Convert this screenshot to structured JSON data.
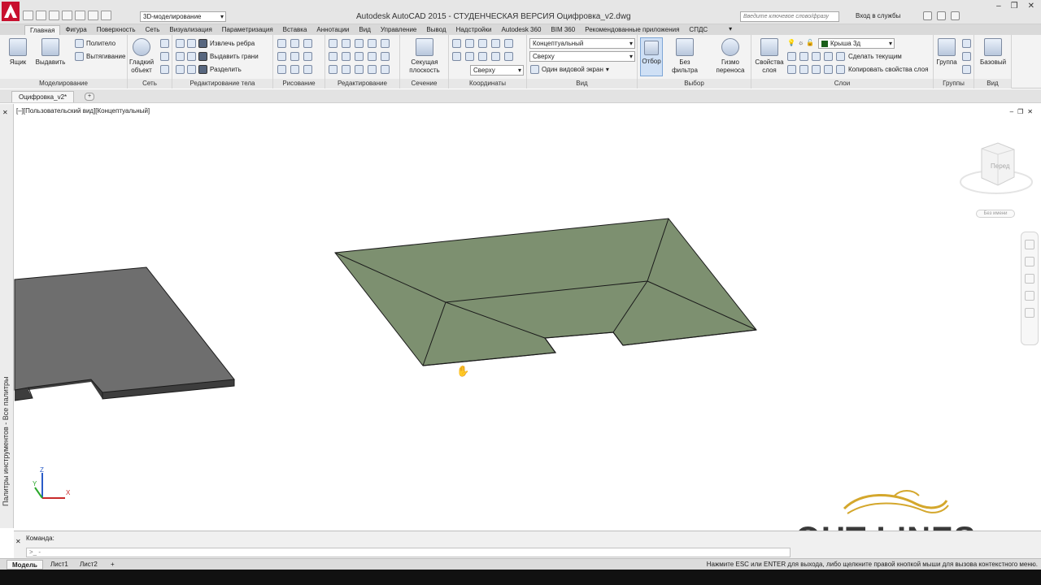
{
  "titlebar": {
    "workspace": "3D-моделирование",
    "title": "Autodesk AutoCAD 2015 - СТУДЕНЧЕСКАЯ ВЕРСИЯ    Оцифровка_v2.dwg",
    "search_placeholder": "Введите ключевое слово/фразу",
    "signin": "Вход в службы"
  },
  "ribbon_tabs": [
    "Главная",
    "Фигура",
    "Поверхность",
    "Сеть",
    "Визуализация",
    "Параметризация",
    "Вставка",
    "Аннотации",
    "Вид",
    "Управление",
    "Вывод",
    "Надстройки",
    "Autodesk 360",
    "BIM 360",
    "Рекомендованные приложения",
    "СПДС"
  ],
  "ribbon": {
    "modeling": {
      "title": "Моделирование",
      "box": "Ящик",
      "extrude": "Выдавить",
      "polysolid": "Политело",
      "presspull": "Вытягивание"
    },
    "mesh": {
      "title": "Сеть",
      "smooth": "Гладкий объект"
    },
    "solid_edit": {
      "title": "Редактирование тела",
      "extract_edges": "Извлечь ребра",
      "extrude_faces": "Выдавить грани",
      "separate": "Разделить"
    },
    "draw": {
      "title": "Рисование"
    },
    "modify": {
      "title": "Редактирование"
    },
    "section": {
      "title": "Сечение",
      "plane": "Секущая плоскость"
    },
    "coordinates": {
      "title": "Координаты",
      "combo": "Сверху"
    },
    "view": {
      "title": "Вид",
      "visual_style": "Концептуальный",
      "view_dir": "Сверху",
      "single_vp": "Один видовой экран"
    },
    "selection": {
      "title": "Выбор",
      "culling": "Отбор",
      "no_filter": "Без фильтра",
      "gizmo": "Гизмо переноса"
    },
    "layers": {
      "title": "Слои",
      "properties": "Свойства слоя",
      "layer": "Крыша 3д",
      "make_current": "Сделать текущим",
      "match": "Копировать свойства слоя"
    },
    "groups": {
      "title": "Группы",
      "group": "Группа"
    },
    "base": {
      "title": "Вид",
      "base": "Базовый"
    }
  },
  "file_tab": "Оцифровка_v2*",
  "viewport": {
    "label": "[–][Пользовательский вид][Концептуальный]",
    "viewcube_face": "Перед",
    "unnamed_ucs": "Без имени"
  },
  "palette": {
    "title": "Палитры инструментов - Все палитры"
  },
  "command": {
    "history": "Команда:",
    "prompt": ">_ -"
  },
  "status": {
    "tabs": [
      "Модель",
      "Лист1",
      "Лист2"
    ],
    "message": "Нажмите ESC или ENTER для выхода, либо щелкните правой кнопкой мыши для вызова контекстного меню."
  },
  "watermark": "OUT-LINES",
  "colors": {
    "roof_fill": "#7d9070",
    "slab_fill": "#6e6e6e",
    "accent": "#c8102e",
    "gold": "#d4a72c"
  }
}
